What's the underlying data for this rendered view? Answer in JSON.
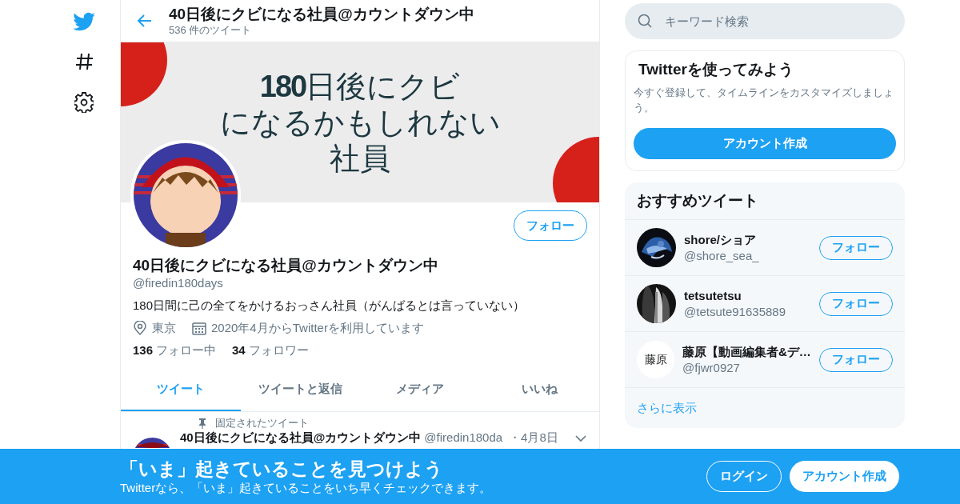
{
  "header": {
    "title": "40日後にクビになる社員@カウントダウン中",
    "tweet_count": "536 件のツイート"
  },
  "banner": {
    "lines": [
      "**180**日後にクビ",
      "になるかもしれない",
      "社員"
    ]
  },
  "profile": {
    "follow_button": "フォロー",
    "name": "40日後にクビになる社員@カウントダウン中",
    "handle": "@firedin180days",
    "bio": "180日間に己の全てをかけるおっさん社員（がんばるとは言っていない）",
    "location": "東京",
    "joined": "2020年4月からTwitterを利用しています",
    "following": {
      "count": "136",
      "label": "フォロー中"
    },
    "followers": {
      "count": "34",
      "label": "フォロワー"
    }
  },
  "tabs": [
    {
      "label": "ツイート",
      "selected": true
    },
    {
      "label": "ツイートと返信",
      "selected": false
    },
    {
      "label": "メディア",
      "selected": false
    },
    {
      "label": "いいね",
      "selected": false
    }
  ],
  "pinned_tweet": {
    "pin_label": "固定されたツイート",
    "author": "40日後にクビになる社員@カウントダウン中",
    "handle": "@firedin180da",
    "date": "・4月8日"
  },
  "search": {
    "placeholder": "キーワード検索"
  },
  "signup_card": {
    "title": "Twitterを使ってみよう",
    "text": "今すぐ登録して、タイムラインをカスタマイズしましょう。",
    "button": "アカウント作成"
  },
  "suggestions": {
    "title": "おすすめツイート",
    "more": "さらに表示",
    "users": [
      {
        "name": "shore/ショア",
        "handle": "@shore_sea_",
        "button": "フォロー"
      },
      {
        "name": "tetsutetsu",
        "handle": "@tetsute91635889",
        "button": "フォロー"
      },
      {
        "name": "藤原【動画編集者&デ…",
        "handle": "@fjwr0927",
        "button": "フォロー",
        "avatar": {
          "kind": "text",
          "text": "藤原"
        }
      }
    ]
  },
  "bottom_bar": {
    "title": "「いま」起きていることを見つけよう",
    "subtitle": "Twitterなら、「いま」起きていることをいち早くチェックできます。",
    "login": "ログイン",
    "signup": "アカウント作成"
  }
}
